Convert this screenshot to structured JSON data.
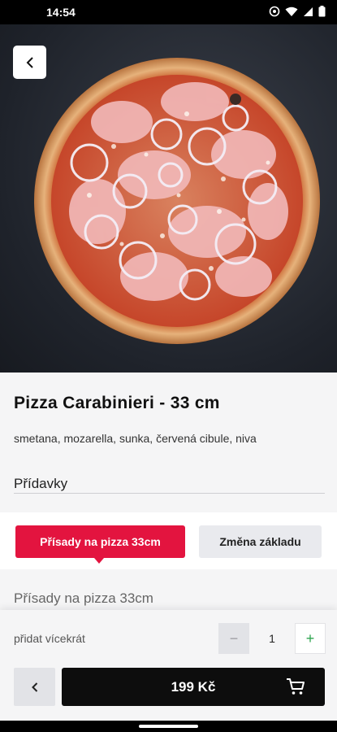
{
  "status": {
    "time": "14:54",
    "icons": [
      "alarm-icon",
      "wifi-icon",
      "signal-icon",
      "battery-icon"
    ]
  },
  "hero": {
    "image": "pizza-photo",
    "back_icon": "chevron-left-icon"
  },
  "product": {
    "title": "Pizza Carabinieri - 33 cm",
    "description": "smetana, mozarella, sunka, červená cibule, niva"
  },
  "extras": {
    "section_title": "Přídavky",
    "tabs": [
      {
        "label": "Přísady na pizza 33cm",
        "active": true
      },
      {
        "label": "Změna základu",
        "active": false
      }
    ],
    "group_title": "Přísady na pizza 33cm"
  },
  "quantity": {
    "label": "přidat vícekrát",
    "minus": "−",
    "value": "1",
    "plus": "+"
  },
  "cart": {
    "price": "199 Kč",
    "icon": "cart-icon",
    "prev_icon": "chevron-left-icon"
  },
  "colors": {
    "accent": "#e3143f",
    "dark": "#0d0d0d",
    "plus": "#2ea44f"
  }
}
